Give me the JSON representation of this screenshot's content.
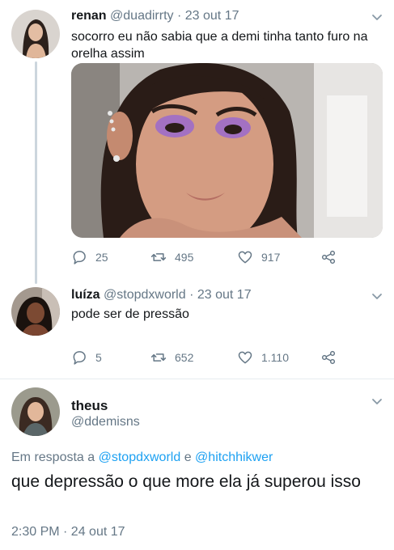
{
  "tweets": [
    {
      "name": "renan",
      "handle": "@duadirrty",
      "separator": "·",
      "date": "23 out 17",
      "text": "socorro eu não sabia que a demi tinha tanto furo na orelha assim",
      "replies": "25",
      "retweets": "495",
      "likes": "917"
    },
    {
      "name": "luíza",
      "handle": "@stopdxworld",
      "separator": "·",
      "date": "23 out 17",
      "text": "pode ser de pressão",
      "replies": "5",
      "retweets": "652",
      "likes": "1.110"
    }
  ],
  "main_tweet": {
    "name": "theus",
    "handle": "@ddemisns",
    "reply_prefix": "Em resposta a",
    "reply_user1": "@stopdxworld",
    "reply_conjunction": "e",
    "reply_user2": "@hitchhikwer",
    "text": "que depressão o que more ela já superou isso",
    "timestamp": "2:30 PM · 24 out 17"
  },
  "colors": {
    "link": "#1da1f2",
    "muted": "#657786",
    "text": "#14171a",
    "thread_line": "#ccd6dd"
  },
  "icons": {
    "reply": "reply-icon",
    "retweet": "retweet-icon",
    "like": "heart-icon",
    "share": "share-icon",
    "menu": "chevron-down-icon"
  }
}
